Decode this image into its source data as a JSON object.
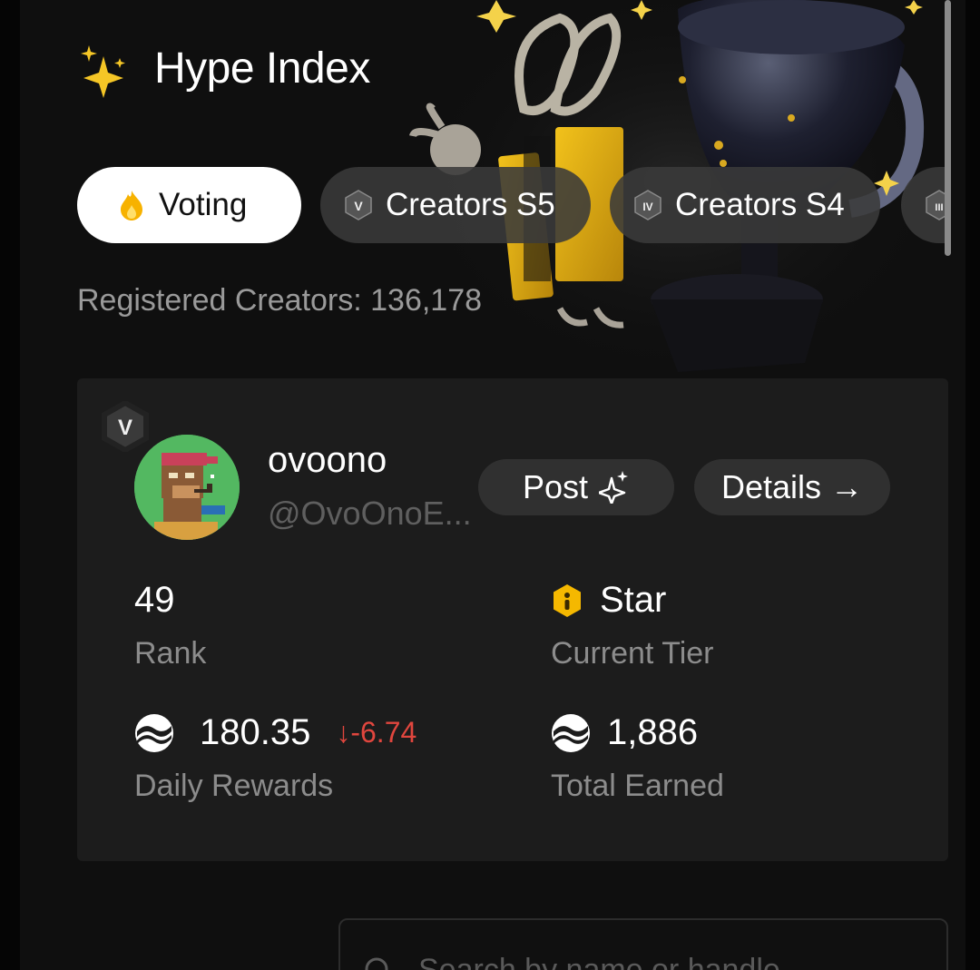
{
  "header": {
    "title": "Hype Index",
    "icon": "sparkles-icon"
  },
  "tabs": [
    {
      "label": "Voting",
      "icon": "flame-icon",
      "active": true
    },
    {
      "label": "Creators S5",
      "badge": "V",
      "active": false
    },
    {
      "label": "Creators S4",
      "badge": "IV",
      "active": false
    },
    {
      "label": "",
      "badge": "III",
      "active": false
    }
  ],
  "registered": {
    "text": "Registered Creators: 136,178"
  },
  "profile": {
    "season_badge": "V",
    "name": "ovoono",
    "handle": "@OvoOnoE...",
    "post_label": "Post",
    "details_label": "Details →",
    "rank": {
      "value": "49",
      "label": "Rank"
    },
    "tier": {
      "value": "Star",
      "label": "Current Tier",
      "icon_color": "#f5b800"
    },
    "daily": {
      "value": "180.35",
      "delta": "↓-6.74",
      "label": "Daily Rewards"
    },
    "total": {
      "value": "1,886",
      "label": "Total Earned"
    }
  },
  "search": {
    "placeholder": "Search by name or handle"
  },
  "colors": {
    "background": "#0f0f0f",
    "card": "#1c1c1c",
    "negative": "#e0463e",
    "tier": "#f5b800"
  }
}
